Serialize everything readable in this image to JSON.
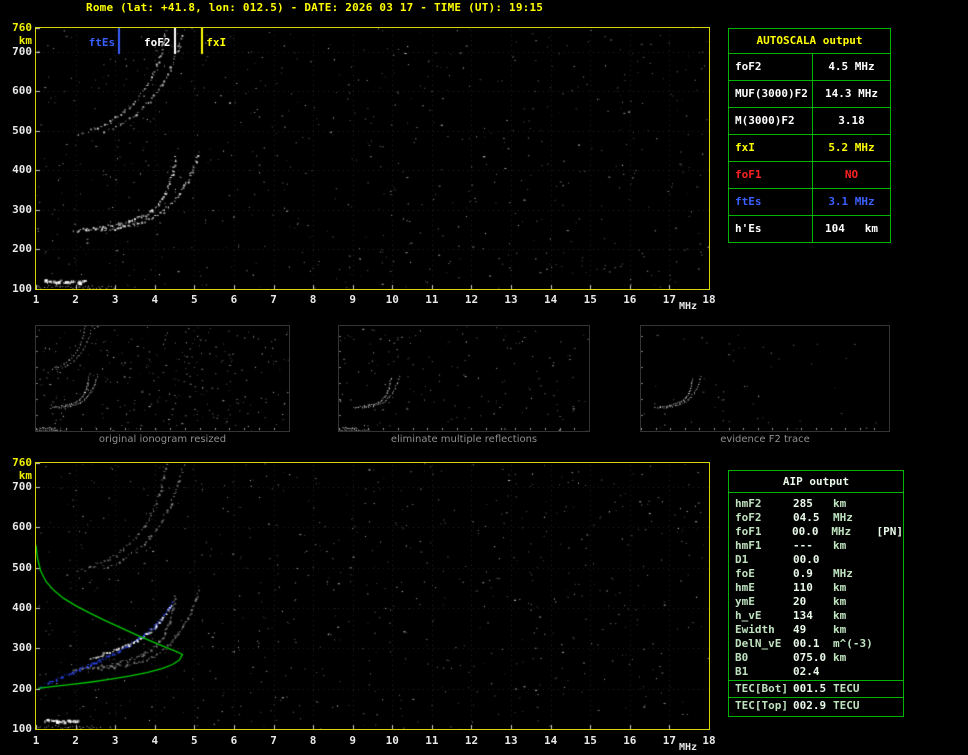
{
  "title": "Rome (lat: +41.8, lon: 012.5) - DATE: 2026 03 17 - TIME (UT): 19:15",
  "colors": {
    "background": "#000000",
    "title": "#ffff00",
    "panel_border": "#d8d800",
    "table_border": "#00b400",
    "white": "#ffffff",
    "red": "#ff2222",
    "blue": "#3a5fff",
    "yellow": "#ffff00",
    "profile_green": "#00cc00",
    "caption_gray": "#8f8f8f"
  },
  "autoscala_table": {
    "header": "AUTOSCALA output",
    "rows": [
      {
        "label": "foF2",
        "value": "4.5 MHz",
        "color": "#ffffff"
      },
      {
        "label": "MUF(3000)F2",
        "value": "14.3 MHz",
        "color": "#ffffff"
      },
      {
        "label": "M(3000)F2",
        "value": "3.18",
        "color": "#ffffff"
      },
      {
        "label": "fxI",
        "value": "5.2 MHz",
        "color": "#ffff00"
      },
      {
        "label": "foF1",
        "value": "NO",
        "color": "#ff2222"
      },
      {
        "label": "ftEs",
        "value": "3.1 MHz",
        "color": "#3a5fff"
      },
      {
        "label": "h'Es",
        "value": "104   km",
        "color": "#ffffff"
      }
    ]
  },
  "aip_table": {
    "header": "AIP output",
    "rows": [
      [
        "hmF2",
        "285",
        "km",
        ""
      ],
      [
        "foF2",
        "04.5",
        "MHz",
        ""
      ],
      [
        "foF1",
        "00.0",
        "MHz",
        "[PN]"
      ],
      [
        "hmF1",
        "---",
        "km",
        ""
      ],
      [
        "D1",
        "00.0",
        "",
        ""
      ],
      [
        "foE",
        "0.9",
        "MHz",
        ""
      ],
      [
        "hmE",
        "110",
        "km",
        ""
      ],
      [
        "ymE",
        "20",
        "km",
        ""
      ],
      [
        "h_vE",
        "134",
        "km",
        ""
      ],
      [
        "Ewidth",
        "49",
        "km",
        ""
      ],
      [
        "DelN_vE",
        "00.1",
        "m^(-3)",
        ""
      ],
      [
        "B0",
        "075.0",
        "km",
        ""
      ],
      [
        "B1",
        "02.4",
        "",
        ""
      ]
    ],
    "tec_rows": [
      [
        "TEC[Bot]",
        "001.5",
        "TECU",
        ""
      ],
      [
        "TEC[Top]",
        "002.9",
        "TECU",
        ""
      ]
    ]
  },
  "thumbnails": [
    {
      "caption": "original ionogram resized",
      "noise_density": 0.012,
      "show": [
        "es_blob",
        "es_tail",
        "f2_o",
        "f2_x",
        "hop2",
        "hop2_x"
      ]
    },
    {
      "caption": "eliminate multiple reflections",
      "noise_density": 0.006,
      "show": [
        "es_blob",
        "es_tail",
        "f2_o",
        "f2_x"
      ]
    },
    {
      "caption": "evidence F2 trace",
      "noise_density": 0.002,
      "show": [
        "f2_o",
        "f2_x"
      ]
    }
  ],
  "chart_data": [
    {
      "type": "scatter",
      "name": "autoscaled ionogram",
      "xlabel": "MHz",
      "ylabel": "km",
      "xlim": [
        1,
        18
      ],
      "ylim": [
        100,
        760
      ],
      "xticks": [
        1,
        2,
        3,
        4,
        5,
        6,
        7,
        8,
        9,
        10,
        11,
        12,
        13,
        14,
        15,
        16,
        17,
        18
      ],
      "yticks": [
        760,
        700,
        600,
        500,
        400,
        300,
        200,
        100
      ],
      "noise_density": 0.004,
      "markers": [
        {
          "name": "ftEs",
          "x": 3.1,
          "color": "#3a5fff",
          "side": "left"
        },
        {
          "name": "foF2",
          "x": 4.5,
          "color": "#ffffff",
          "side": "left"
        },
        {
          "name": "fxI",
          "x": 5.2,
          "color": "#ffff00",
          "side": "right"
        }
      ],
      "series": [
        {
          "id": "es_blob",
          "name": "Es layer strong echo",
          "color": "#ffffff",
          "size": 3,
          "gap": 1.5,
          "points": [
            [
              1.2,
              122
            ],
            [
              1.5,
              120
            ],
            [
              1.9,
              121
            ],
            [
              2.2,
              120
            ]
          ]
        },
        {
          "id": "es_tail",
          "name": "Es layer echo",
          "color": "#dddddd",
          "size": 1,
          "gap": 2.5,
          "points": [
            [
              1.05,
              107
            ],
            [
              1.6,
              106
            ],
            [
              2.3,
              106
            ],
            [
              3.0,
              105
            ]
          ]
        },
        {
          "id": "f2_o",
          "name": "F2 ordinary trace",
          "color": "#f0f0f0",
          "size": 2,
          "gap": 2,
          "points": [
            [
              1.95,
              249
            ],
            [
              2.3,
              253
            ],
            [
              2.7,
              258
            ],
            [
              3.05,
              265
            ],
            [
              3.35,
              273
            ],
            [
              3.65,
              284
            ],
            [
              3.9,
              298
            ],
            [
              4.1,
              316
            ],
            [
              4.25,
              340
            ],
            [
              4.37,
              370
            ],
            [
              4.45,
              402
            ],
            [
              4.5,
              434
            ]
          ]
        },
        {
          "id": "f2_x",
          "name": "F2 extraordinary trace",
          "color": "#d8d8d8",
          "size": 2,
          "gap": 2.2,
          "points": [
            [
              2.55,
              250
            ],
            [
              2.95,
              255
            ],
            [
              3.3,
              261
            ],
            [
              3.65,
              270
            ],
            [
              3.95,
              282
            ],
            [
              4.2,
              297
            ],
            [
              4.4,
              316
            ],
            [
              4.6,
              340
            ],
            [
              4.78,
              368
            ],
            [
              4.92,
              398
            ],
            [
              5.02,
              426
            ],
            [
              5.08,
              445
            ]
          ]
        },
        {
          "id": "hop2",
          "name": "F2 second hop",
          "color": "#cccccc",
          "size": 2,
          "gap": 3,
          "points": [
            [
              2.05,
              492
            ],
            [
              2.45,
              506
            ],
            [
              2.85,
              524
            ],
            [
              3.2,
              548
            ],
            [
              3.5,
              576
            ],
            [
              3.75,
              608
            ],
            [
              3.95,
              645
            ],
            [
              4.1,
              686
            ],
            [
              4.2,
              724
            ],
            [
              4.28,
              758
            ]
          ]
        },
        {
          "id": "hop2_x",
          "name": "F2 second hop extraordinary",
          "color": "#bbbbbb",
          "size": 2,
          "gap": 3.5,
          "points": [
            [
              2.7,
              498
            ],
            [
              3.1,
              516
            ],
            [
              3.5,
              542
            ],
            [
              3.85,
              575
            ],
            [
              4.15,
              615
            ],
            [
              4.4,
              662
            ],
            [
              4.6,
              715
            ],
            [
              4.72,
              756
            ]
          ]
        }
      ]
    },
    {
      "type": "scatter",
      "name": "ionogram with restored trace and electron density profile",
      "xlabel": "MHz",
      "ylabel": "km",
      "xlim": [
        1,
        18
      ],
      "ylim": [
        100,
        760
      ],
      "xticks": [
        1,
        2,
        3,
        4,
        5,
        6,
        7,
        8,
        9,
        10,
        11,
        12,
        13,
        14,
        15,
        16,
        17,
        18
      ],
      "yticks": [
        760,
        700,
        600,
        500,
        400,
        300,
        200,
        100
      ],
      "noise_density": 0.004,
      "markers": [],
      "series": [
        {
          "id": "es_blob",
          "name": "Es layer strong echo",
          "color": "#ffffff",
          "size": 3,
          "gap": 1.5,
          "points": [
            [
              1.2,
              122
            ],
            [
              1.6,
              120
            ],
            [
              2.0,
              121
            ]
          ]
        },
        {
          "id": "es_tail",
          "name": "Es layer echo",
          "color": "#cccccc",
          "size": 1,
          "gap": 2.5,
          "points": [
            [
              1.05,
              107
            ],
            [
              1.8,
              106
            ],
            [
              2.6,
              105
            ]
          ]
        },
        {
          "id": "f2_o_gray",
          "name": "F2 ordinary trace (measured)",
          "color": "#909090",
          "size": 2,
          "gap": 2.2,
          "points": [
            [
              1.95,
              249
            ],
            [
              2.3,
              253
            ],
            [
              2.7,
              258
            ],
            [
              3.05,
              265
            ],
            [
              3.35,
              273
            ],
            [
              3.65,
              284
            ],
            [
              3.9,
              298
            ],
            [
              4.1,
              316
            ],
            [
              4.25,
              340
            ],
            [
              4.37,
              370
            ],
            [
              4.45,
              402
            ],
            [
              4.5,
              434
            ]
          ]
        },
        {
          "id": "f2_x_gray",
          "name": "F2 extraordinary trace (measured)",
          "color": "#858585",
          "size": 2,
          "gap": 2.4,
          "points": [
            [
              2.55,
              250
            ],
            [
              2.95,
              255
            ],
            [
              3.3,
              261
            ],
            [
              3.65,
              270
            ],
            [
              3.95,
              282
            ],
            [
              4.2,
              297
            ],
            [
              4.4,
              316
            ],
            [
              4.6,
              340
            ],
            [
              4.78,
              368
            ],
            [
              4.92,
              398
            ],
            [
              5.02,
              426
            ],
            [
              5.08,
              445
            ]
          ]
        },
        {
          "id": "hop2_gray",
          "name": "F2 second hop (measured)",
          "color": "#8a8a8a",
          "size": 2,
          "gap": 3,
          "points": [
            [
              2.05,
              492
            ],
            [
              2.45,
              506
            ],
            [
              2.85,
              524
            ],
            [
              3.2,
              548
            ],
            [
              3.5,
              576
            ],
            [
              3.75,
              608
            ],
            [
              3.95,
              645
            ],
            [
              4.1,
              686
            ],
            [
              4.2,
              724
            ],
            [
              4.28,
              758
            ]
          ]
        },
        {
          "id": "hop2_x_gray",
          "name": "F2 second hop extraordinary (measured)",
          "color": "#808080",
          "size": 2,
          "gap": 3.5,
          "points": [
            [
              2.7,
              498
            ],
            [
              3.1,
              516
            ],
            [
              3.5,
              542
            ],
            [
              3.85,
              575
            ],
            [
              4.15,
              615
            ],
            [
              4.4,
              662
            ],
            [
              4.6,
              715
            ],
            [
              4.72,
              756
            ]
          ]
        },
        {
          "id": "restored",
          "name": "restored trace",
          "color": "#2e4bff",
          "size": 2,
          "gap": 1.6,
          "points": [
            [
              1.1,
              206
            ],
            [
              1.35,
              216
            ],
            [
              1.6,
              227
            ],
            [
              1.85,
              238
            ],
            [
              2.1,
              249
            ],
            [
              2.35,
              260
            ],
            [
              2.6,
              271
            ],
            [
              2.85,
              283
            ],
            [
              3.1,
              296
            ],
            [
              3.35,
              310
            ],
            [
              3.6,
              326
            ],
            [
              3.85,
              344
            ],
            [
              4.05,
              362
            ],
            [
              4.2,
              380
            ],
            [
              4.32,
              398
            ],
            [
              4.42,
              416
            ]
          ]
        },
        {
          "id": "trace_white",
          "name": "selected F2 trace",
          "color": "#ffffff",
          "size": 2,
          "gap": 1.8,
          "points": [
            [
              2.35,
              277
            ],
            [
              2.7,
              287
            ],
            [
              3.0,
              297
            ],
            [
              3.3,
              309
            ],
            [
              3.6,
              324
            ],
            [
              3.85,
              341
            ],
            [
              4.05,
              359
            ],
            [
              4.2,
              377
            ],
            [
              4.32,
              395
            ],
            [
              4.4,
              410
            ]
          ]
        },
        {
          "id": "profile",
          "name": "electron density profile",
          "mode": "line",
          "color": "#00cc00",
          "points": [
            [
              1.0,
              556
            ],
            [
              1.04,
              522
            ],
            [
              1.12,
              492
            ],
            [
              1.25,
              466
            ],
            [
              1.45,
              444
            ],
            [
              1.7,
              424
            ],
            [
              2.0,
              406
            ],
            [
              2.35,
              388
            ],
            [
              2.75,
              369
            ],
            [
              3.15,
              351
            ],
            [
              3.55,
              333
            ],
            [
              3.95,
              316
            ],
            [
              4.3,
              302
            ],
            [
              4.55,
              292
            ],
            [
              4.7,
              285
            ],
            [
              4.62,
              271
            ],
            [
              4.45,
              260
            ],
            [
              4.18,
              250
            ],
            [
              3.8,
              240
            ],
            [
              3.35,
              231
            ],
            [
              2.85,
              223
            ],
            [
              2.35,
              216
            ],
            [
              1.85,
              210
            ],
            [
              1.4,
              205
            ],
            [
              1.05,
              201
            ]
          ]
        }
      ]
    }
  ]
}
